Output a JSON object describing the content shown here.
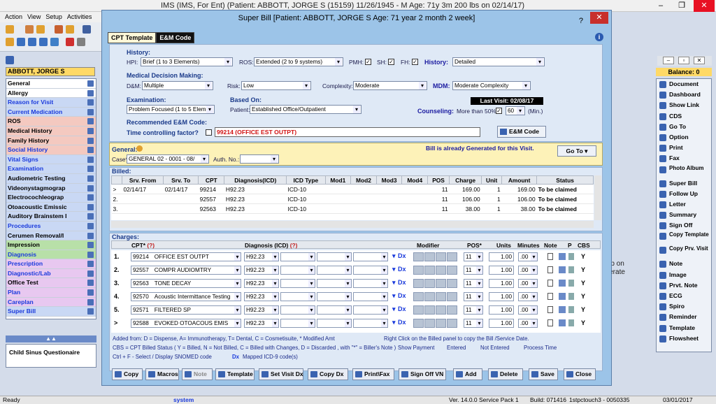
{
  "app_title": "IMS (IMS, For Ent)    (Patient: ABBOTT, JORGE S (15159) 11/26/1945 - M Age: 71y 3m   200 lbs on 02/14/17)",
  "menu": [
    "Action",
    "View",
    "Setup",
    "Activities"
  ],
  "patient_name": "ABBOTT, JORGE S",
  "balance": "Balance: 0",
  "left_items": [
    {
      "label": "General",
      "bg": "#ffffff",
      "color": "#000"
    },
    {
      "label": "Allergy",
      "bg": "#ffffff",
      "color": "#000"
    },
    {
      "label": "Reason for Visit",
      "bg": "#c9d8f4",
      "color": "#1a3adc"
    },
    {
      "label": "Current Medication",
      "bg": "#c9d8f4",
      "color": "#1a3adc"
    },
    {
      "label": "ROS",
      "bg": "#f4c9c0",
      "color": "#000"
    },
    {
      "label": "Medical History",
      "bg": "#f4c9c0",
      "color": "#000"
    },
    {
      "label": "Family History",
      "bg": "#f4c9c0",
      "color": "#000"
    },
    {
      "label": "Social History",
      "bg": "#f4c9c0",
      "color": "#1a3adc"
    },
    {
      "label": "Vital Signs",
      "bg": "#c9d8f4",
      "color": "#1a3adc"
    },
    {
      "label": "Examination",
      "bg": "#c9d8f4",
      "color": "#1a3adc"
    },
    {
      "label": "Audiometric Testing",
      "bg": "#c9d8f4",
      "color": "#000"
    },
    {
      "label": "Videonystagmograp",
      "bg": "#c9d8f4",
      "color": "#000"
    },
    {
      "label": "Electrocochleograp",
      "bg": "#c9d8f4",
      "color": "#000"
    },
    {
      "label": "Otoacoustic Emissic",
      "bg": "#c9d8f4",
      "color": "#000"
    },
    {
      "label": "Auditory Brainstem I",
      "bg": "#c9d8f4",
      "color": "#000"
    },
    {
      "label": "Procedures",
      "bg": "#c9d8f4",
      "color": "#1a3adc"
    },
    {
      "label": "Cerumen Removal/I",
      "bg": "#c9d8f4",
      "color": "#000"
    },
    {
      "label": "Impression",
      "bg": "#b8e0a8",
      "color": "#000"
    },
    {
      "label": "Diagnosis",
      "bg": "#b8e0a8",
      "color": "#1a3adc"
    },
    {
      "label": "Prescription",
      "bg": "#e8c8f0",
      "color": "#1a3adc"
    },
    {
      "label": "Diagnostic/Lab",
      "bg": "#e8c8f0",
      "color": "#1a3adc"
    },
    {
      "label": "Office Test",
      "bg": "#e8c8f0",
      "color": "#000"
    },
    {
      "label": "Plan",
      "bg": "#e8c8f0",
      "color": "#1a3adc"
    },
    {
      "label": "Careplan",
      "bg": "#e8c8f0",
      "color": "#1a3adc"
    },
    {
      "label": "Super Bill",
      "bg": "#c9d8f4",
      "color": "#1a3adc"
    }
  ],
  "child_questionnaire": "Child Sinus Questionaire",
  "right_items": [
    "Document",
    "Dashboard",
    "Show Link",
    "CDS",
    "Go To",
    "Option",
    "Print",
    "Fax",
    "Photo Album",
    "Super Bill",
    "Follow Up",
    "Letter",
    "Summary",
    "Sign Off",
    "Copy Template",
    "Copy Prv. Visit",
    "Note",
    "Image",
    "Prvt. Note",
    "ECG",
    "Spiro",
    "Reminder",
    "Template",
    "Flowsheet"
  ],
  "bg_text": [
    "s up on",
    "oderate"
  ],
  "dialog": {
    "title": "Super Bill  [Patient: ABBOTT, JORGE S  Age: 71 year 2 month 2 week]",
    "help": "?",
    "tabs": [
      "CPT Template",
      "E&M Code"
    ],
    "history": {
      "heading": "History:",
      "hpi_label": "HPI:",
      "hpi": "Brief (1 to 3 Elements)",
      "ros_label": "ROS:",
      "ros": "Extended (2 to 9 systems)",
      "pmh_label": "PMH:",
      "sh_label": "SH:",
      "fh_label": "FH:",
      "history_label": "History:",
      "history_value": "Detailed"
    },
    "mdm": {
      "heading": "Medical Decision Making:",
      "dm_label": "D&M:",
      "dm": "Multiple",
      "risk_label": "Risk:",
      "risk": "Low",
      "complexity_label": "Complexity:",
      "complexity": "Moderate",
      "mdm_label": "MDM:",
      "mdm_value": "Moderate Complexity"
    },
    "exam": {
      "heading": "Examination:",
      "value": "Problem Focused (1 to 5 Elemen"
    },
    "based_on": {
      "heading": "Based On:",
      "patient_label": "Patient:",
      "value": "Established Office/Outpatient"
    },
    "last_visit": "Last Visit: 02/08/17",
    "counseling": {
      "label": "Counseling:",
      "more_than": "More than 50%:",
      "value": "60",
      "unit": "(Min.)"
    },
    "recommended": {
      "heading": "Recommended E&M Code:",
      "time_label": "Time controlling factor?",
      "code": "99214  (OFFICE EST OUTPT)",
      "button": "E&M Code"
    },
    "general": {
      "label": "General:",
      "case_label": "Case*",
      "case": "GENERAL 02  -  0001 - 08/",
      "auth_label": "Auth. No.:",
      "generated": "Bill is already Generated for this Visit.",
      "goto": "Go To"
    },
    "billed": {
      "heading": "Billed:",
      "columns": [
        "Srv. From",
        "Srv. To",
        "CPT",
        "Diagnosis(ICD)",
        "ICD Type",
        "Mod1",
        "Mod2",
        "Mod3",
        "Mod4",
        "POS",
        "Charge",
        "Unit",
        "Amount",
        "Status"
      ],
      "rows": [
        {
          "n": ">",
          "from": "02/14/17",
          "to": "02/14/17",
          "cpt": "99214",
          "dx": "H92.23",
          "type": "ICD-10",
          "pos": "11",
          "charge": "169.00",
          "unit": "1",
          "amount": "169.00",
          "status": "To be claimed"
        },
        {
          "n": "2.",
          "from": "",
          "to": "",
          "cpt": "92557",
          "dx": "H92.23",
          "type": "ICD-10",
          "pos": "11",
          "charge": "106.00",
          "unit": "1",
          "amount": "106.00",
          "status": "To be claimed"
        },
        {
          "n": "3.",
          "from": "",
          "to": "",
          "cpt": "92563",
          "dx": "H92.23",
          "type": "ICD-10",
          "pos": "11",
          "charge": "38.00",
          "unit": "1",
          "amount": "38.00",
          "status": "To be claimed"
        }
      ]
    },
    "charges": {
      "heading": "Charges:",
      "col_cpt": "CPT*",
      "col_cpt_q": "(?)",
      "col_dx": "Diagnosis (ICD)",
      "col_dx_q": "(?)",
      "col_modifier": "Modifier",
      "col_pos": "POS*",
      "col_units": "Units",
      "col_minutes": "Minutes",
      "col_note": "Note",
      "col_p": "P",
      "col_cbs": "CBS",
      "rows": [
        {
          "n": "1.",
          "cpt": "99214",
          "desc": "OFFICE EST OUTPT",
          "dx": "H92.23",
          "dxlbl": "Dx",
          "pos": "11",
          "units": "1.00",
          "min": ".00",
          "cbs": "Y"
        },
        {
          "n": "2.",
          "cpt": "92557",
          "desc": "COMPR AUDIOMTRY",
          "dx": "H92.23",
          "dxlbl": "Dx",
          "pos": "11",
          "units": "1.00",
          "min": ".00",
          "cbs": "Y"
        },
        {
          "n": "3.",
          "cpt": "92563",
          "desc": "TONE DECAY",
          "dx": "H92.23",
          "dxlbl": "Dx",
          "pos": "11",
          "units": "1.00",
          "min": ".00",
          "cbs": "Y"
        },
        {
          "n": "4.",
          "cpt": "92570",
          "desc": "Acoustic Intermittance Testing",
          "dx": "H92.23",
          "dxlbl": "Dx",
          "pos": "11",
          "units": "1.00",
          "min": ".00",
          "cbs": "Y"
        },
        {
          "n": "5.",
          "cpt": "92571",
          "desc": "FILTERED SP",
          "dx": "H92.23",
          "dxlbl": "Dx",
          "pos": "11",
          "units": "1.00",
          "min": ".00",
          "cbs": "Y"
        },
        {
          "n": ">",
          "cpt": "92588",
          "desc": "EVOKED OTOACOUS EMIS",
          "dx": "H92.23",
          "dxlbl": "Dx",
          "pos": "11",
          "units": "1.00",
          "min": ".00",
          "cbs": "Y"
        }
      ],
      "legend1": "Added from: D = Dispense, A= Immunotherapy, T= Dental,  C = Cosmetisuite,   * Modified Amt",
      "legend2": "CBS = CPT Billed Status ( Y = Billed, N = Not Billed, C = Billed with Changes, D = Discarded , with \"*\" = Biller's Note )",
      "legend3": "Ctrl + F - Select / Display SNOMED code",
      "legend4": "Right Click on the Billed panel to copy the Bill /Service Date.",
      "legend5": "Show Payment",
      "legend6": "Entered",
      "legend7": "Not Entered",
      "legend8": "Process Time",
      "legend9": "Mapped ICD-9 code(s)"
    },
    "buttons": [
      "Copy",
      "Macros",
      "Note",
      "Template",
      "Set Visit Dx",
      "Copy Dx",
      "Print\\Fax",
      "Sign Off VN",
      "Add",
      "Delete",
      "Save",
      "Close"
    ]
  },
  "status": {
    "ready": "Ready",
    "user": "system",
    "version": "Ver. 14.0.0 Service Pack 1",
    "build": "Build: 071416",
    "station": "1stpctouch3 - 0050335",
    "date": "03/01/2017"
  }
}
